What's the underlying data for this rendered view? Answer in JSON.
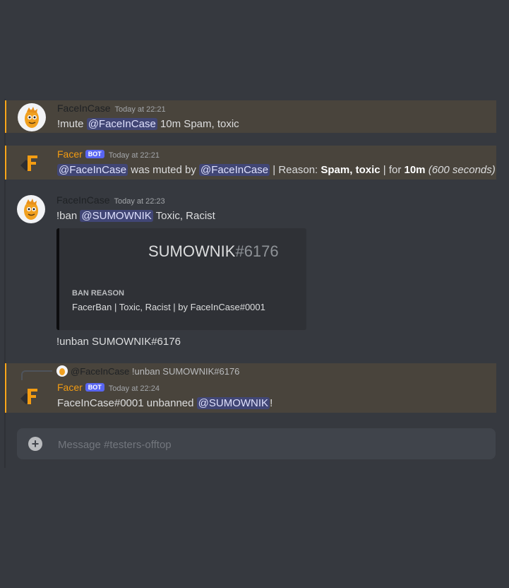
{
  "channel": {
    "composer_placeholder": "Message #testers-offtop"
  },
  "messages": [
    {
      "author": "FaceInCase",
      "timestamp": "Today at 22:21",
      "content": {
        "prefix": "!mute ",
        "mention": "@FaceInCase",
        "suffix": " 10m Spam, toxic"
      }
    },
    {
      "author": "Facer",
      "bot_tag": "BOT",
      "timestamp": "Today at 22:21",
      "content": {
        "mention1": "@FaceInCase",
        "text1": " was muted by ",
        "mention2": "@FaceInCase",
        "text2": " | Reason: ",
        "reason": "Spam, toxic",
        "text3": " | for ",
        "duration": "10m",
        "seconds": " (600 seconds)"
      }
    },
    {
      "author": "FaceInCase",
      "timestamp": "Today at 22:23",
      "content": {
        "prefix": "!ban ",
        "mention": "@SUMOWNIK",
        "suffix": " Toxic, Racist"
      },
      "embed": {
        "title_name": "SUMOWNIK",
        "title_disc": "#6176",
        "field_name": "BAN REASON",
        "field_value": "FacerBan | Toxic, Racist | by FaceInCase#0001"
      },
      "followup": "!unban SUMOWNIK#6176"
    },
    {
      "author": "Facer",
      "bot_tag": "BOT",
      "timestamp": "Today at 22:24",
      "reply": {
        "author": "@FaceInCase",
        "text": "!unban SUMOWNIK#6176"
      },
      "content": {
        "prefix": "FaceInCase#0001 unbanned ",
        "mention": "@SUMOWNIK",
        "suffix": "!"
      }
    }
  ],
  "colors": {
    "mention_bg": "#49443c",
    "mention_border": "#faa61a",
    "bot_name": "#f39c12",
    "bot_tag": "#5865f2"
  }
}
